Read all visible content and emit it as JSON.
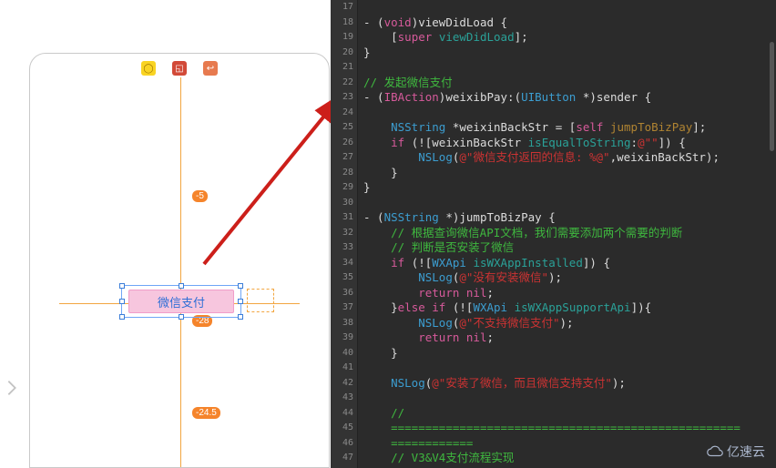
{
  "ib": {
    "button_title": "微信支付",
    "badge_minus5": "-5",
    "badge_minus28": "-28",
    "badge_minus24": "-24.5"
  },
  "watermark": "亿速云",
  "code": {
    "first_line_number": 17,
    "lines": [
      [
        {
          "c": ""
        }
      ],
      [
        {
          "c": "- ("
        },
        {
          "k": "kw",
          "c": "void"
        },
        {
          "c": ")viewDidLoad {"
        }
      ],
      [
        {
          "c": "    ["
        },
        {
          "k": "super",
          "c": "super"
        },
        {
          "c": " "
        },
        {
          "k": "msg",
          "c": "viewDidLoad"
        },
        {
          "c": "];"
        }
      ],
      [
        {
          "c": "}"
        }
      ],
      [
        {
          "c": ""
        }
      ],
      [
        {
          "k": "cmt",
          "c": "// 发起微信支付"
        }
      ],
      [
        {
          "c": "- ("
        },
        {
          "k": "kw",
          "c": "IBAction"
        },
        {
          "c": ")weixibPay:("
        },
        {
          "k": "type",
          "c": "UIButton"
        },
        {
          "c": " *)sender {"
        }
      ],
      [
        {
          "c": "    "
        }
      ],
      [
        {
          "c": "    "
        },
        {
          "k": "type",
          "c": "NSString"
        },
        {
          "c": " *weixinBackStr = ["
        },
        {
          "k": "self",
          "c": "self"
        },
        {
          "c": " "
        },
        {
          "k": "gold",
          "c": "jumpToBizPay"
        },
        {
          "c": "];"
        }
      ],
      [
        {
          "c": "    "
        },
        {
          "k": "kw",
          "c": "if"
        },
        {
          "c": " (![weixinBackStr "
        },
        {
          "k": "msg",
          "c": "isEqualToString"
        },
        {
          "c": ":"
        },
        {
          "k": "at",
          "c": "@\"\""
        },
        {
          "c": "]) {"
        }
      ],
      [
        {
          "c": "        "
        },
        {
          "k": "type",
          "c": "NSLog"
        },
        {
          "c": "("
        },
        {
          "k": "str",
          "c": "@\"微信支付返回的信息: %@\""
        },
        {
          "c": ",weixinBackStr);"
        }
      ],
      [
        {
          "c": "    }"
        }
      ],
      [
        {
          "c": "}"
        }
      ],
      [
        {
          "c": ""
        }
      ],
      [
        {
          "c": "- ("
        },
        {
          "k": "type",
          "c": "NSString"
        },
        {
          "c": " *)jumpToBizPay {"
        }
      ],
      [
        {
          "c": "    "
        },
        {
          "k": "cmt",
          "c": "// 根据查询微信API文档，我们需要添加两个需要的判断"
        }
      ],
      [
        {
          "c": "    "
        },
        {
          "k": "cmt",
          "c": "// 判断是否安装了微信"
        }
      ],
      [
        {
          "c": "    "
        },
        {
          "k": "kw",
          "c": "if"
        },
        {
          "c": " (!["
        },
        {
          "k": "type",
          "c": "WXApi"
        },
        {
          "c": " "
        },
        {
          "k": "msg",
          "c": "isWXAppInstalled"
        },
        {
          "c": "]) {"
        }
      ],
      [
        {
          "c": "        "
        },
        {
          "k": "type",
          "c": "NSLog"
        },
        {
          "c": "("
        },
        {
          "k": "str",
          "c": "@\"没有安装微信\""
        },
        {
          "c": ");"
        }
      ],
      [
        {
          "c": "        "
        },
        {
          "k": "kw",
          "c": "return"
        },
        {
          "c": " "
        },
        {
          "k": "kw",
          "c": "nil"
        },
        {
          "c": ";"
        }
      ],
      [
        {
          "c": "    }"
        },
        {
          "k": "kw",
          "c": "else"
        },
        {
          "c": " "
        },
        {
          "k": "kw",
          "c": "if"
        },
        {
          "c": " (!["
        },
        {
          "k": "type",
          "c": "WXApi"
        },
        {
          "c": " "
        },
        {
          "k": "msg",
          "c": "isWXAppSupportApi"
        },
        {
          "c": "]){"
        }
      ],
      [
        {
          "c": "        "
        },
        {
          "k": "type",
          "c": "NSLog"
        },
        {
          "c": "("
        },
        {
          "k": "str",
          "c": "@\"不支持微信支付\""
        },
        {
          "c": ");"
        }
      ],
      [
        {
          "c": "        "
        },
        {
          "k": "kw",
          "c": "return"
        },
        {
          "c": " "
        },
        {
          "k": "kw",
          "c": "nil"
        },
        {
          "c": ";"
        }
      ],
      [
        {
          "c": "    }"
        }
      ],
      [
        {
          "c": "    "
        }
      ],
      [
        {
          "c": "    "
        },
        {
          "k": "type",
          "c": "NSLog"
        },
        {
          "c": "("
        },
        {
          "k": "str",
          "c": "@\"安装了微信，而且微信支持支付\""
        },
        {
          "c": ");"
        }
      ],
      [
        {
          "c": "    "
        }
      ],
      [
        {
          "c": "    "
        },
        {
          "k": "cmt",
          "c": "//"
        }
      ],
      [
        {
          "c": "    "
        },
        {
          "k": "cmt",
          "c": "==================================================="
        }
      ],
      [
        {
          "c": "    "
        },
        {
          "k": "cmt",
          "c": "============"
        }
      ],
      [
        {
          "c": "    "
        },
        {
          "k": "cmt",
          "c": "// V3&V4支付流程实现"
        }
      ]
    ]
  }
}
